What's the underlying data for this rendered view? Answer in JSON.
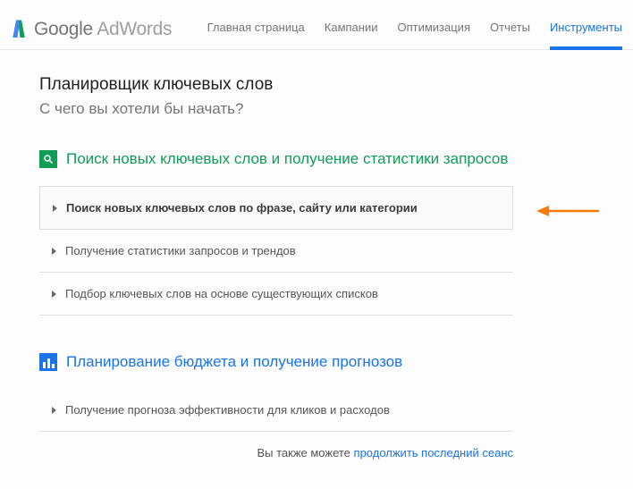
{
  "header": {
    "logo_google": "Google",
    "logo_adwords": " AdWords",
    "nav": [
      {
        "label": "Главная страница",
        "active": false
      },
      {
        "label": "Кампании",
        "active": false
      },
      {
        "label": "Оптимизация",
        "active": false
      },
      {
        "label": "Отчеты",
        "active": false
      },
      {
        "label": "Инструменты",
        "active": true
      }
    ]
  },
  "page": {
    "title": "Планировщик ключевых слов",
    "subtitle": "С чего вы хотели бы начать?"
  },
  "section_search": {
    "title": "Поиск новых ключевых слов и получение статистики запросов",
    "options": [
      "Поиск новых ключевых слов по фразе, сайту или категории",
      "Получение статистики запросов и трендов",
      "Подбор ключевых слов на основе существующих списков"
    ]
  },
  "section_budget": {
    "title": "Планирование бюджета и получение прогнозов",
    "options": [
      "Получение прогноза эффективности для кликов и расходов"
    ]
  },
  "footer": {
    "prefix": "Вы также можете ",
    "link": "продолжить последний сеанс"
  }
}
